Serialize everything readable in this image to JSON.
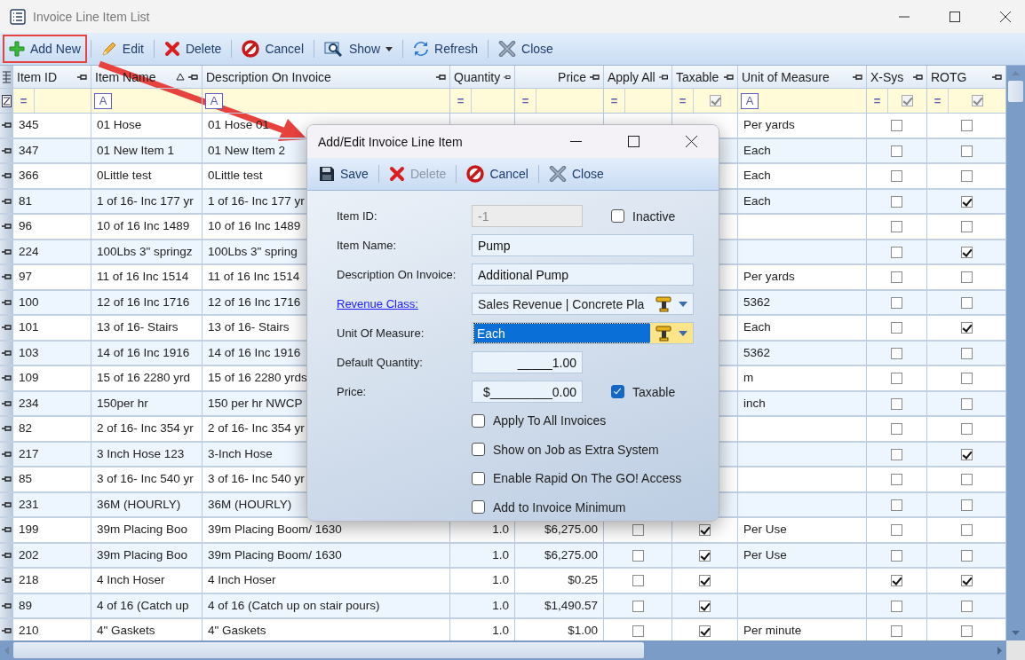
{
  "window": {
    "title": "Invoice Line Item List"
  },
  "toolbar": [
    {
      "label": "Add New",
      "kind": "add",
      "highlighted": true,
      "dropdown": false
    },
    {
      "label": "Edit",
      "kind": "edit",
      "highlighted": false,
      "dropdown": false
    },
    {
      "label": "Delete",
      "kind": "delete",
      "highlighted": false,
      "dropdown": false
    },
    {
      "label": "Cancel",
      "kind": "cancel",
      "highlighted": false,
      "dropdown": false
    },
    {
      "label": "Show",
      "kind": "show",
      "highlighted": false,
      "dropdown": true
    },
    {
      "label": "Refresh",
      "kind": "refresh",
      "highlighted": false,
      "dropdown": false
    },
    {
      "label": "Close",
      "kind": "close",
      "highlighted": false,
      "dropdown": false
    }
  ],
  "table": {
    "columns": [
      {
        "label": "Item ID",
        "kind": "text",
        "sorted": false,
        "filter": {
          "kind": "equals",
          "operator": "="
        }
      },
      {
        "label": "Item Name",
        "kind": "text",
        "sorted": true,
        "filter": {
          "kind": "text",
          "operator": "A"
        }
      },
      {
        "label": "Description On Invoice",
        "kind": "text",
        "sorted": false,
        "filter": {
          "kind": "text",
          "operator": "A"
        }
      },
      {
        "label": "Quantity",
        "kind": "number",
        "sorted": false,
        "filter": {
          "kind": "equals",
          "operator": "="
        }
      },
      {
        "label": "Price",
        "kind": "number",
        "sorted": false,
        "filter": {
          "kind": "equals",
          "operator": "="
        }
      },
      {
        "label": "Apply All",
        "kind": "check",
        "sorted": false,
        "filter": {
          "kind": "equals",
          "operator": "="
        }
      },
      {
        "label": "Taxable",
        "kind": "check",
        "sorted": false,
        "filter": {
          "kind": "check",
          "operator": "=",
          "checked": true
        }
      },
      {
        "label": "Unit of Measure",
        "kind": "text",
        "sorted": false,
        "filter": {
          "kind": "text",
          "operator": "A"
        }
      },
      {
        "label": "X-Sys",
        "kind": "check",
        "sorted": false,
        "filter": {
          "kind": "check",
          "operator": "=",
          "checked": true
        }
      },
      {
        "label": "ROTG",
        "kind": "check",
        "sorted": false,
        "filter": {
          "kind": "check",
          "operator": "=",
          "checked": true
        }
      }
    ],
    "rows": [
      {
        "cells": [
          "345",
          "01 Hose",
          "01 Hose 01",
          null,
          null,
          null,
          null,
          "Per yards",
          false,
          false
        ]
      },
      {
        "cells": [
          "347",
          "01 New Item 1",
          "01 New Item 2",
          null,
          null,
          null,
          null,
          "Each",
          false,
          false
        ]
      },
      {
        "cells": [
          "366",
          "0Little test",
          "0Little test",
          null,
          null,
          null,
          null,
          "Each",
          false,
          false
        ]
      },
      {
        "cells": [
          "81",
          "1 of 16- Inc 177 yr",
          "1 of 16- Inc 177 yr",
          null,
          null,
          null,
          null,
          "Each",
          false,
          true
        ]
      },
      {
        "cells": [
          "96",
          "10 of 16 Inc 1489",
          "10 of 16 Inc 1489",
          null,
          null,
          null,
          null,
          null,
          false,
          false
        ]
      },
      {
        "cells": [
          "224",
          "100Lbs 3\" springz",
          "100Lbs 3\" spring",
          null,
          null,
          null,
          null,
          null,
          false,
          true
        ]
      },
      {
        "cells": [
          "97",
          "11 of 16 Inc 1514",
          "11 of 16 Inc 1514",
          null,
          null,
          null,
          null,
          "Per yards",
          false,
          false
        ]
      },
      {
        "cells": [
          "100",
          "12 of 16 Inc 1716",
          "12 of 16 Inc 1716",
          null,
          null,
          null,
          null,
          "5362",
          false,
          false
        ]
      },
      {
        "cells": [
          "101",
          "13 of 16- Stairs",
          "13 of 16- Stairs",
          null,
          null,
          null,
          null,
          "Each",
          false,
          true
        ]
      },
      {
        "cells": [
          "103",
          "14 of 16 Inc 1916",
          "14 of 16 Inc 1916",
          null,
          null,
          null,
          null,
          "5362",
          false,
          false
        ]
      },
      {
        "cells": [
          "109",
          "15 of 16 2280 yrd",
          "15 of 16 2280 yrds",
          null,
          null,
          null,
          null,
          "m",
          false,
          false
        ]
      },
      {
        "cells": [
          "234",
          "150per hr",
          "150 per hr NWCP",
          null,
          null,
          null,
          null,
          "inch",
          false,
          false
        ]
      },
      {
        "cells": [
          "82",
          "2 of 16- Inc 354 yr",
          "2 of 16- Inc 354 yr",
          null,
          null,
          null,
          null,
          null,
          false,
          false
        ]
      },
      {
        "cells": [
          "217",
          "3 Inch Hose 123",
          "3-Inch Hose",
          null,
          null,
          null,
          null,
          null,
          false,
          true
        ]
      },
      {
        "cells": [
          "85",
          "3 of 16- Inc 540 yr",
          "3 of 16- Inc 540 yr",
          null,
          null,
          null,
          null,
          null,
          false,
          false
        ]
      },
      {
        "cells": [
          "231",
          "36M (HOURLY)",
          "36M (HOURLY)",
          null,
          null,
          null,
          null,
          null,
          false,
          false
        ]
      },
      {
        "cells": [
          "199",
          "39m Placing Boo",
          "39m Placing Boom/ 1630",
          "1.0",
          "$6,275.00",
          false,
          true,
          "Per Use",
          false,
          false
        ]
      },
      {
        "cells": [
          "202",
          "39m Placing Boo",
          "39m Placing Boom/ 1630",
          "1.0",
          "$6,275.00",
          false,
          true,
          "Per Use",
          false,
          false
        ]
      },
      {
        "cells": [
          "218",
          "4 Inch Hoser",
          "4 Inch Hoser",
          "1.0",
          "$0.25",
          false,
          true,
          null,
          true,
          true
        ]
      },
      {
        "cells": [
          "89",
          "4 of 16 (Catch up",
          "4 of 16 (Catch up on stair pours)",
          "1.0",
          "$1,490.57",
          false,
          true,
          null,
          false,
          false
        ]
      },
      {
        "cells": [
          "210",
          "4\" Gaskets",
          "4\" Gaskets",
          "1.0",
          "$1.00",
          false,
          true,
          "Per minute",
          false,
          false
        ]
      }
    ]
  },
  "dialog": {
    "title": "Add/Edit Invoice Line Item",
    "toolbar": [
      {
        "label": "Save",
        "kind": "save",
        "disabled": false
      },
      {
        "label": "Delete",
        "kind": "delete",
        "disabled": true
      },
      {
        "label": "Cancel",
        "kind": "cancel",
        "disabled": false
      },
      {
        "label": "Close",
        "kind": "close",
        "disabled": false
      }
    ],
    "fields": [
      {
        "label": "Item ID:",
        "kind": "text",
        "value": "-1",
        "disabled": true,
        "short": true,
        "link": false,
        "side_check": {
          "label": "Inactive",
          "checked": false
        }
      },
      {
        "label": "Item Name:",
        "kind": "text",
        "value": "Pump",
        "disabled": false,
        "short": false,
        "link": false
      },
      {
        "label": "Description On Invoice:",
        "kind": "text",
        "value": "Additional Pump",
        "disabled": false,
        "short": false,
        "link": false
      },
      {
        "label": "Revenue Class:",
        "kind": "combo",
        "value": "Sales Revenue |  Concrete Pla",
        "selected": false,
        "link": true
      },
      {
        "label": "Unit Of Measure:",
        "kind": "combo",
        "value": "Each",
        "selected": true,
        "link": false
      },
      {
        "label": "Default Quantity:",
        "kind": "number",
        "value": "_____1.00",
        "disabled": false,
        "short": true,
        "link": false
      },
      {
        "label": "Price:",
        "kind": "number",
        "value": "$_________0.00",
        "disabled": false,
        "short": true,
        "link": false,
        "side_check": {
          "label": "Taxable",
          "checked": true
        }
      }
    ],
    "options": [
      {
        "label": "Apply To All Invoices",
        "checked": false
      },
      {
        "label": "Show on Job as Extra System",
        "checked": false
      },
      {
        "label": "Enable Rapid On The GO! Access",
        "checked": false
      },
      {
        "label": "Add to Invoice Minimum",
        "checked": false
      }
    ]
  },
  "annotation": {
    "arrow": true
  }
}
